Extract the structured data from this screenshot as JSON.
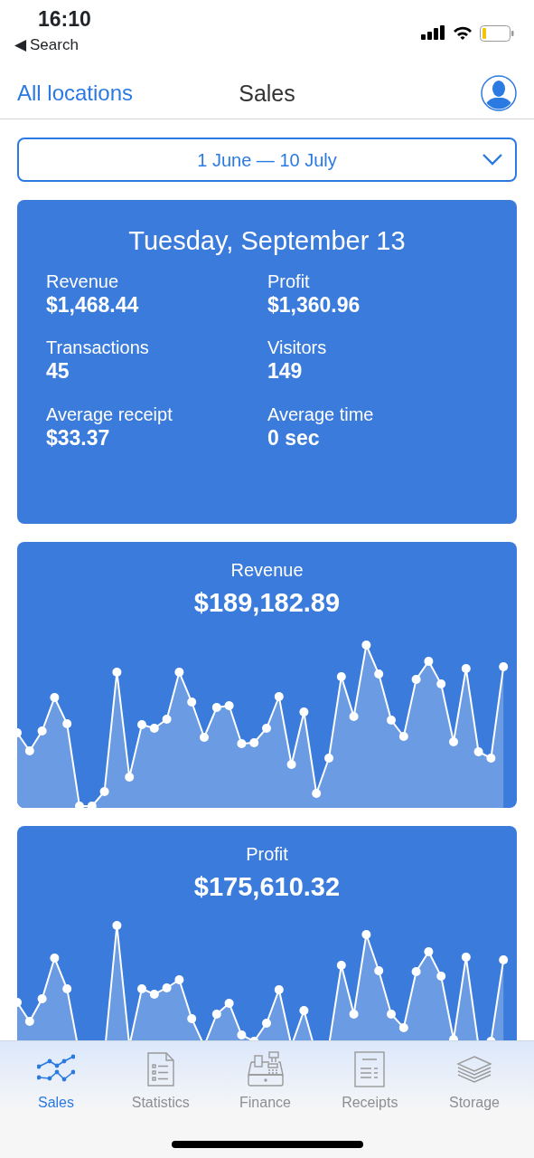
{
  "status_bar": {
    "time": "16:10",
    "back_arrow": "◀",
    "back_label": "Search"
  },
  "header": {
    "left_link": "All locations",
    "title": "Sales"
  },
  "date_range": {
    "label": "1 June — 10 July"
  },
  "summary": {
    "title": "Tuesday, September 13",
    "stats": [
      {
        "label": "Revenue",
        "value": "$1,468.44"
      },
      {
        "label": "Profit",
        "value": "$1,360.96"
      },
      {
        "label": "Transactions",
        "value": "45"
      },
      {
        "label": "Visitors",
        "value": "149"
      },
      {
        "label": "Average receipt",
        "value": "$33.37"
      },
      {
        "label": "Average time",
        "value": "0 sec"
      }
    ]
  },
  "charts": [
    {
      "title": "Revenue",
      "total": "$189,182.89"
    },
    {
      "title": "Profit",
      "total": "$175,610.32"
    }
  ],
  "tabs": [
    {
      "label": "Sales",
      "selected": true
    },
    {
      "label": "Statistics",
      "selected": false
    },
    {
      "label": "Finance",
      "selected": false
    },
    {
      "label": "Receipts",
      "selected": false
    },
    {
      "label": "Storage",
      "selected": false
    }
  ]
}
